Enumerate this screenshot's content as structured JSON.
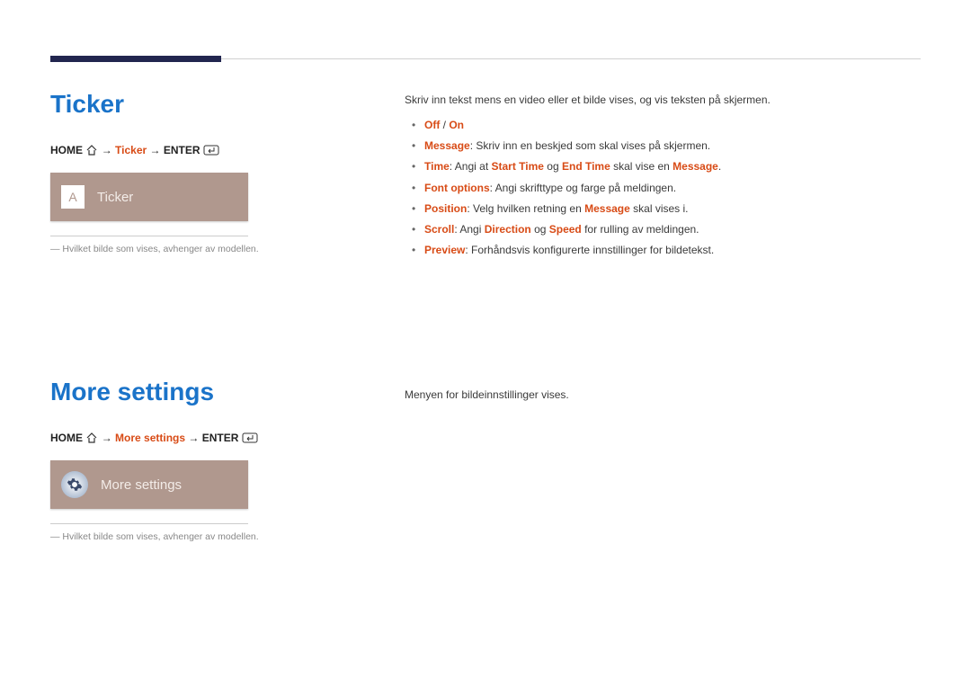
{
  "sections": {
    "ticker": {
      "heading": "Ticker",
      "breadcrumb": {
        "home": "HOME",
        "target": "Ticker",
        "enter": "ENTER"
      },
      "thumb_label": "Ticker",
      "thumb_icon_letter": "A",
      "note_prefix": "―",
      "note": "Hvilket bilde som vises, avhenger av modellen.",
      "intro": "Skriv inn tekst mens en video eller et bilde vises, og vis teksten på skjermen.",
      "options": {
        "offon": {
          "off": "Off",
          "slash": " / ",
          "on": "On"
        },
        "message": {
          "key": "Message",
          "rest": ": Skriv inn en beskjed som skal vises på skjermen."
        },
        "time": {
          "key": "Time",
          "t1": ": Angi at ",
          "k2": "Start Time",
          "t2": " og ",
          "k3": "End Time",
          "t3": " skal vise en ",
          "k4": "Message",
          "t4": "."
        },
        "font": {
          "key": "Font options",
          "rest": ": Angi skrifttype og farge på meldingen."
        },
        "position": {
          "key": "Position",
          "t1": ": Velg hvilken retning en ",
          "k2": "Message",
          "t2": " skal vises i."
        },
        "scroll": {
          "key": "Scroll",
          "t1": ": Angi ",
          "k2": "Direction",
          "t2": " og ",
          "k3": "Speed",
          "t3": " for rulling av meldingen."
        },
        "preview": {
          "key": "Preview",
          "rest": ": Forhåndsvis konfigurerte innstillinger for bildetekst."
        }
      }
    },
    "more": {
      "heading": "More settings",
      "breadcrumb": {
        "home": "HOME",
        "target": "More settings",
        "enter": "ENTER"
      },
      "thumb_label": "More settings",
      "note_prefix": "―",
      "note": "Hvilket bilde som vises, avhenger av modellen.",
      "intro": "Menyen for bildeinnstillinger vises."
    }
  }
}
